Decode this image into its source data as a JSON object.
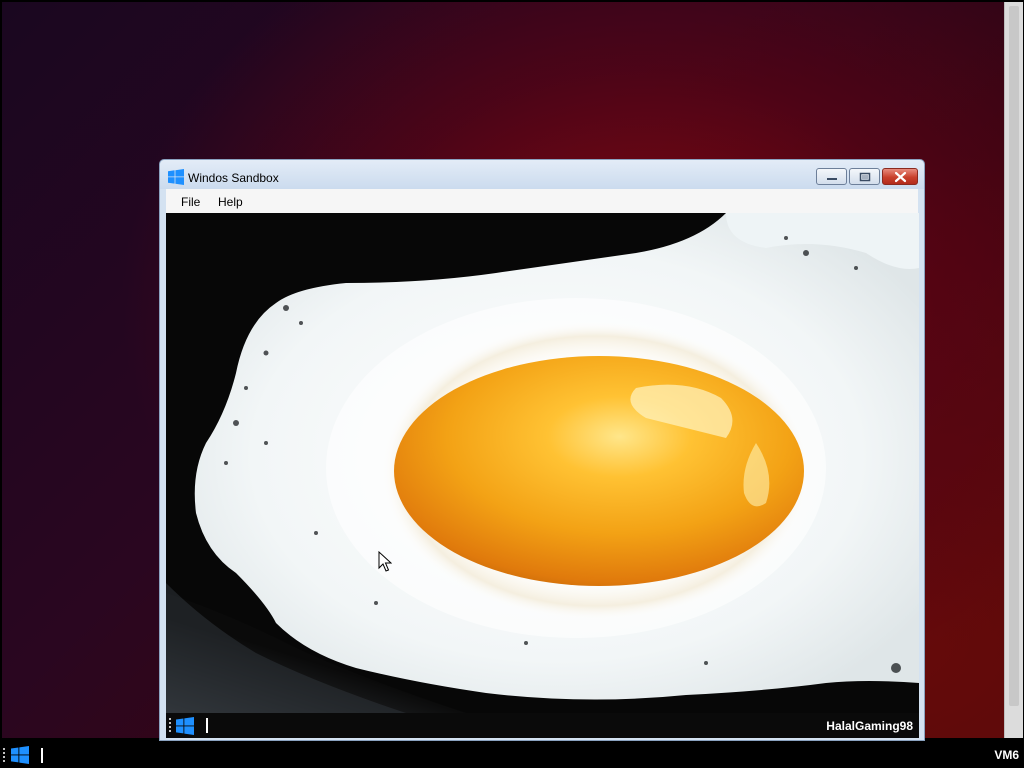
{
  "window": {
    "title": "Windos Sandbox",
    "icon": "windows-logo-icon"
  },
  "menu": {
    "file_label": "File",
    "help_label": "Help"
  },
  "guest": {
    "wallpaper": "fried-egg-photo",
    "username": "HalalGaming98"
  },
  "host": {
    "machine_label": "VM6"
  },
  "colors": {
    "windows_blue": "#1e90ff",
    "close_red": "#c9412d",
    "titlebar": "#d4e2f1"
  }
}
